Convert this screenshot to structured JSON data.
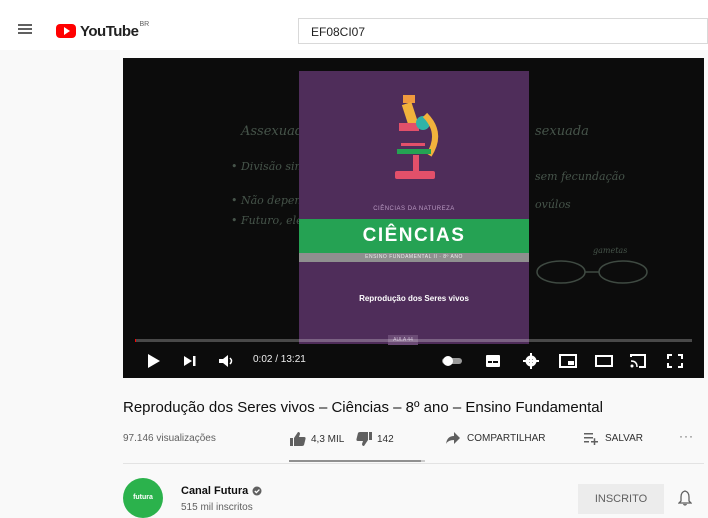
{
  "header": {
    "logo_text": "YouTube",
    "region": "BR",
    "search_value": "EF08CI07"
  },
  "player": {
    "card": {
      "collection_label": "CIÊNCIAS DA NATUREZA",
      "subject": "CIÊNCIAS",
      "grade": "ENSINO FUNDAMENTAL II · 8º ANO",
      "lesson_title": "Reprodução dos Seres vivos",
      "lesson_number": "AULA 44"
    },
    "background_notes": [
      "Assexuada",
      "• Divisão simples",
      "• Não depende",
      "• Futuro, ele",
      "sexuada",
      "sem fecundação",
      "ovúlos",
      "gametas"
    ],
    "time": "0:02 / 13:21",
    "progress_fraction": 0.0025
  },
  "video": {
    "title": "Reprodução dos Seres vivos – Ciências – 8º ano – Ensino Fundamental",
    "views": "97.146 visualizações",
    "likes": "4,3 MIL",
    "dislikes": "142",
    "share_label": "COMPARTILHAR",
    "save_label": "SALVAR",
    "more_label": "···",
    "like_ratio": 0.97
  },
  "channel": {
    "avatar_text": "futura",
    "name": "Canal Futura",
    "subscribers": "515 mil inscritos",
    "subscribe_label": "INSCRITO"
  },
  "colors": {
    "brand_red": "#ff0000",
    "card_purple": "#4f2d5a",
    "card_green": "#25a253",
    "avatar_green": "#2bb24c"
  }
}
